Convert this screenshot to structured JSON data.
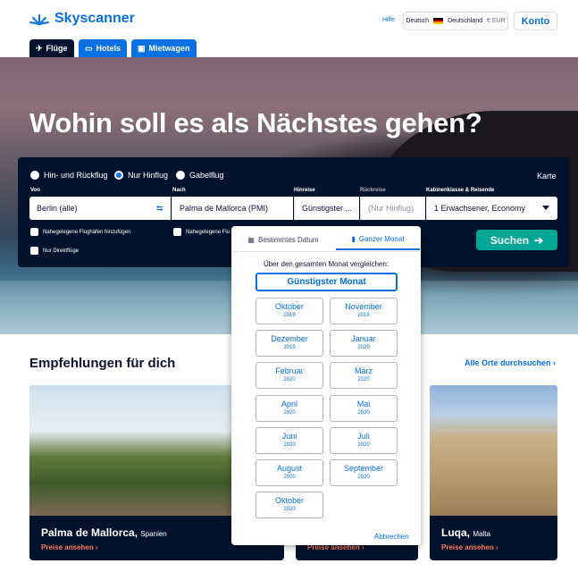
{
  "header": {
    "brand": "Skyscanner",
    "help": "Hilfe",
    "locale_lang": "Deutsch",
    "locale_country": "Deutschland",
    "locale_currency": "€ EUR",
    "account": "Konto"
  },
  "tabs": [
    {
      "label": "Flüge",
      "icon": "plane-icon"
    },
    {
      "label": "Hotels",
      "icon": "bed-icon"
    },
    {
      "label": "Mietwagen",
      "icon": "car-icon"
    }
  ],
  "hero": {
    "headline": "Wohin soll es als Nächstes gehen?"
  },
  "search": {
    "trip_types": [
      {
        "label": "Hin- und Rückflug",
        "selected": false
      },
      {
        "label": "Nur Hinflug",
        "selected": true
      },
      {
        "label": "Gabelflug",
        "selected": false
      }
    ],
    "map_link": "Karte",
    "from_label": "Von",
    "from_value": "Berlin (alle)",
    "to_label": "Nach",
    "to_value": "Palma de Mallorca (PMI)",
    "depart_label": "Hinreise",
    "depart_value": "Günstigster ...",
    "return_label": "Rückreise",
    "return_placeholder": "(Nur Hinflug)",
    "cabin_label": "Kabinenklasse & Reisende",
    "cabin_value": "1 Erwachsener, Economy",
    "nearby_from": "Nahegelegene Flughäfen hinzufügen",
    "nearby_to": "Nahegelegene Flu",
    "direct_only": "Nur Direktflüge",
    "submit": "Suchen"
  },
  "recommendations": {
    "title": "Empfehlungen für dich",
    "all_link": "Alle Orte durchsuchen",
    "cards": [
      {
        "city": "Palma de Mallorca,",
        "country": "Spanien",
        "prices": "Preise ansehen"
      },
      {
        "city": "",
        "country": "",
        "prices": "Preise ansehen"
      },
      {
        "city": "Luqa,",
        "country": "Malta",
        "prices": "Preise ansehen"
      }
    ]
  },
  "datepicker": {
    "tab_specific": "Bestimmtes Datum",
    "tab_month": "Ganzer Monat",
    "compare_text": "Über den gesamten Monat vergleichen:",
    "cheapest_month": "Günstigster Monat",
    "months": [
      {
        "m": "Oktober",
        "y": "2019"
      },
      {
        "m": "November",
        "y": "2019"
      },
      {
        "m": "Dezember",
        "y": "2019"
      },
      {
        "m": "Januar",
        "y": "2020"
      },
      {
        "m": "Februar",
        "y": "2020"
      },
      {
        "m": "März",
        "y": "2020"
      },
      {
        "m": "April",
        "y": "2020"
      },
      {
        "m": "Mai",
        "y": "2020"
      },
      {
        "m": "Juni",
        "y": "2020"
      },
      {
        "m": "Juli",
        "y": "2020"
      },
      {
        "m": "August",
        "y": "2020"
      },
      {
        "m": "September",
        "y": "2020"
      },
      {
        "m": "Oktober",
        "y": "2020"
      }
    ],
    "cancel": "Abbrechen"
  },
  "colors": {
    "brand": "#0770e3",
    "search_bg": "#02122c",
    "cta": "#00a698",
    "accent": "#ff7b59"
  }
}
